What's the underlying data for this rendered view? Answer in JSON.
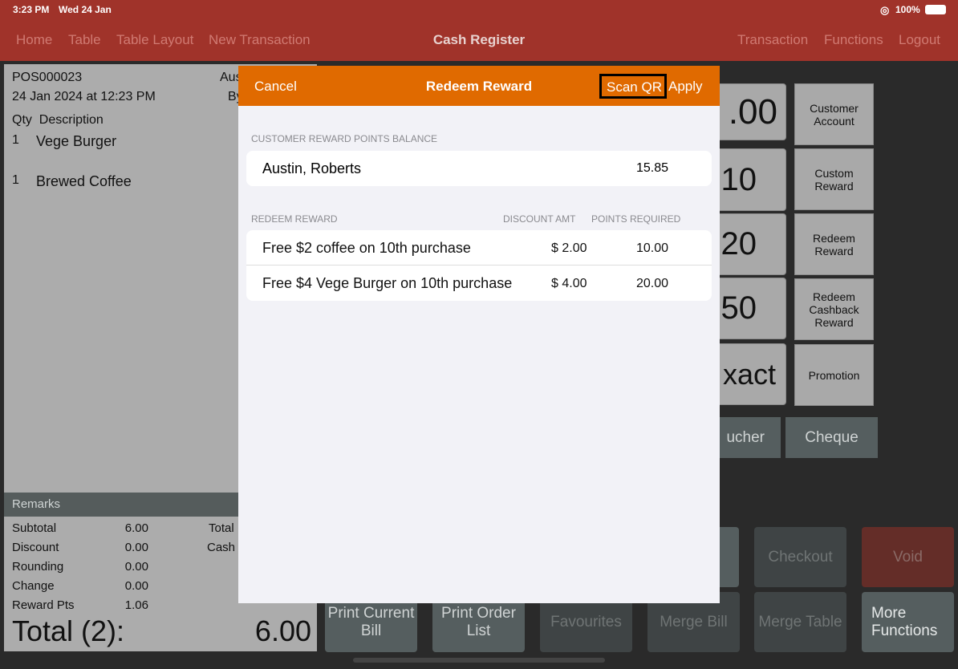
{
  "status": {
    "time": "3:23 PM",
    "date": "Wed 24 Jan",
    "battery": "100%",
    "icons": [
      "wifi-icon",
      "battery-icon"
    ]
  },
  "nav": {
    "left": [
      "Home",
      "Table",
      "Table Layout",
      "New Transaction"
    ],
    "title": "Cash Register",
    "right": [
      "Transaction",
      "Functions",
      "Logout"
    ]
  },
  "receipt": {
    "id": "POS000023",
    "date": "24 Jan 2024 at 12:23 PM",
    "customer_partial": "Aus",
    "by_partial": "By",
    "header": "Qty  Description",
    "items": [
      {
        "qty": "1",
        "desc": "Vege Burger"
      },
      {
        "qty": "1",
        "desc": "Brewed Coffee"
      }
    ],
    "remarks": "Remarks",
    "totals": [
      {
        "label": "Subtotal",
        "value": "6.00"
      },
      {
        "label": "Discount",
        "value": "0.00"
      },
      {
        "label": "Rounding",
        "value": "0.00"
      },
      {
        "label": "Change",
        "value": "0.00"
      },
      {
        "label": "Reward Pts",
        "value": "1.06"
      }
    ],
    "right_labels": [
      "Total",
      "Cash"
    ],
    "grand_label": "Total (2):",
    "grand_value": "6.00"
  },
  "keypad": {
    "amounts": [
      ".00",
      "10",
      "20",
      "50",
      "xact"
    ],
    "side": [
      "Customer Account",
      "Custom Reward",
      "Redeem Reward",
      "Redeem Cashback Reward",
      "Promotion"
    ],
    "voucher": "ucher",
    "cheque": "Cheque"
  },
  "actions": {
    "checkout": "Checkout",
    "void": "Void",
    "print_bill": "Print Current Bill",
    "print_order": "Print Order List",
    "favourites": "Favourites",
    "merge_bill": "Merge Bill",
    "merge_table": "Merge Table",
    "more": "More Functions"
  },
  "modal": {
    "cancel": "Cancel",
    "title": "Redeem Reward",
    "scan": "Scan QR",
    "apply": "Apply",
    "balance_header": "CUSTOMER REWARD POINTS BALANCE",
    "customer": "Austin, Roberts",
    "balance": "15.85",
    "redeem_header": "REDEEM REWARD",
    "col_discount": "DISCOUNT AMT",
    "col_points": "POINTS REQUIRED",
    "rewards": [
      {
        "name": "Free $2 coffee on 10th purchase",
        "discount": "$ 2.00",
        "points": "10.00"
      },
      {
        "name": "Free $4 Vege Burger on 10th purchase",
        "discount": "$ 4.00",
        "points": "20.00"
      }
    ]
  },
  "colors": {
    "nav": "#a0332a",
    "modal_header": "#e06a00",
    "void": "#642d28"
  }
}
